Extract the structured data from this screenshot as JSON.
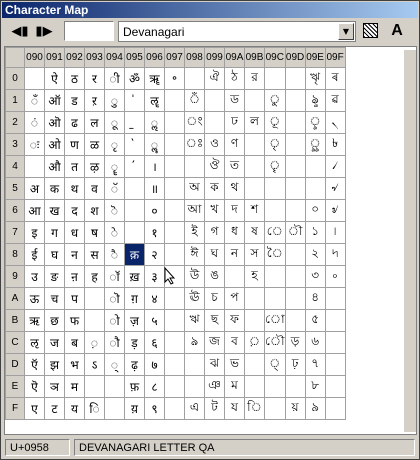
{
  "window": {
    "title": "Character Map"
  },
  "toolbar": {
    "prev_icon": "◀▮",
    "next_icon": "▮▶",
    "code_value": "",
    "script_select": "Devanagari",
    "font_label": "A"
  },
  "grid": {
    "columns": [
      "090",
      "091",
      "092",
      "093",
      "094",
      "095",
      "096",
      "097",
      "098",
      "099",
      "09A",
      "09B",
      "09C",
      "09D",
      "09E",
      "09F"
    ],
    "rows": [
      {
        "label": "0",
        "cells": [
          "",
          "ऐ",
          "ठ",
          "र",
          "ी",
          "ॐ",
          "ॠ",
          "॰",
          "",
          "ঐ",
          "ঠ",
          "র",
          "",
          "",
          "ৠ",
          "ৰ"
        ]
      },
      {
        "label": "1",
        "cells": [
          "ँ",
          "ऑ",
          "ड",
          "ऱ",
          "ु",
          "॑",
          "ॡ",
          "",
          "ঁ",
          "",
          "ড",
          "",
          "ু",
          "",
          "ৡ",
          "ৱ"
        ]
      },
      {
        "label": "2",
        "cells": [
          "ं",
          "ऒ",
          "ढ",
          "ल",
          "ू",
          "॒",
          "ॢ",
          "",
          "ং",
          "",
          "ঢ",
          "ল",
          "ূ",
          "",
          "ৢ",
          "৲"
        ]
      },
      {
        "label": "3",
        "cells": [
          "ः",
          "ओ",
          "ण",
          "ळ",
          "ृ",
          "॓",
          "ॣ",
          "",
          "ঃ",
          "ও",
          "ণ",
          "",
          "ৃ",
          "",
          "ৣ",
          "৳"
        ]
      },
      {
        "label": "4",
        "cells": [
          "",
          "औ",
          "त",
          "ऴ",
          "ॄ",
          "॔",
          "।",
          "",
          "",
          "ঔ",
          "ত",
          "",
          "ৄ",
          "",
          "",
          "৴"
        ]
      },
      {
        "label": "5",
        "cells": [
          "अ",
          "क",
          "थ",
          "व",
          "ॅ",
          "",
          "॥",
          "",
          "অ",
          "ক",
          "থ",
          "",
          "",
          "",
          "",
          "৵"
        ]
      },
      {
        "label": "6",
        "cells": [
          "आ",
          "ख",
          "द",
          "श",
          "ॆ",
          "",
          "०",
          "",
          "আ",
          "খ",
          "দ",
          "শ",
          "",
          "",
          "০",
          "৶"
        ]
      },
      {
        "label": "7",
        "cells": [
          "इ",
          "ग",
          "ध",
          "ष",
          "े",
          "",
          "१",
          "",
          "ই",
          "গ",
          "ধ",
          "ষ",
          "ে",
          "ৗ",
          "১",
          "৷"
        ]
      },
      {
        "label": "8",
        "cells": [
          "ई",
          "घ",
          "न",
          "स",
          "ै",
          "क़",
          "२",
          "",
          "ঈ",
          "ঘ",
          "ন",
          "স",
          "ৈ",
          "",
          "২",
          "৸"
        ]
      },
      {
        "label": "9",
        "cells": [
          "उ",
          "ङ",
          "ऩ",
          "ह",
          "ॉ",
          "ख़",
          "३",
          "",
          "উ",
          "ঙ",
          "",
          "হ",
          "",
          "",
          "৩",
          "৹"
        ]
      },
      {
        "label": "A",
        "cells": [
          "ऊ",
          "च",
          "प",
          "",
          "ॊ",
          "ग़",
          "४",
          "",
          "ঊ",
          "চ",
          "প",
          "",
          "",
          "",
          "৪",
          ""
        ]
      },
      {
        "label": "B",
        "cells": [
          "ऋ",
          "छ",
          "फ",
          "",
          "ो",
          "ज़",
          "५",
          "",
          "ঋ",
          "ছ",
          "ফ",
          "",
          "ো",
          "",
          "৫",
          ""
        ]
      },
      {
        "label": "C",
        "cells": [
          "ऌ",
          "ज",
          "ब",
          "़",
          "ौ",
          "ड़",
          "६",
          "",
          "ঌ",
          "জ",
          "ব",
          "়",
          "ৌ",
          "ড়",
          "৬",
          ""
        ]
      },
      {
        "label": "D",
        "cells": [
          "ऍ",
          "झ",
          "भ",
          "ऽ",
          "्",
          "ढ़",
          "७",
          "",
          "",
          "ঝ",
          "ভ",
          "",
          "্",
          "ঢ়",
          "৭",
          ""
        ]
      },
      {
        "label": "E",
        "cells": [
          "ऎ",
          "ञ",
          "म",
          "",
          "",
          "फ़",
          "८",
          "",
          "",
          "ঞ",
          "ম",
          "",
          "",
          "",
          "৮",
          ""
        ]
      },
      {
        "label": "F",
        "cells": [
          "ए",
          "ट",
          "य",
          "ि",
          "",
          "य़",
          "९",
          "",
          "এ",
          "ট",
          "য",
          "ি",
          "",
          "য়",
          "৯",
          ""
        ]
      }
    ],
    "selected": {
      "row": 8,
      "col": 5
    }
  },
  "status": {
    "codepoint": "U+0958",
    "name": "DEVANAGARI LETTER QA"
  },
  "colors": {
    "selection": "#0a246a",
    "title_start": "#0a246a",
    "title_end": "#a6caf0"
  }
}
